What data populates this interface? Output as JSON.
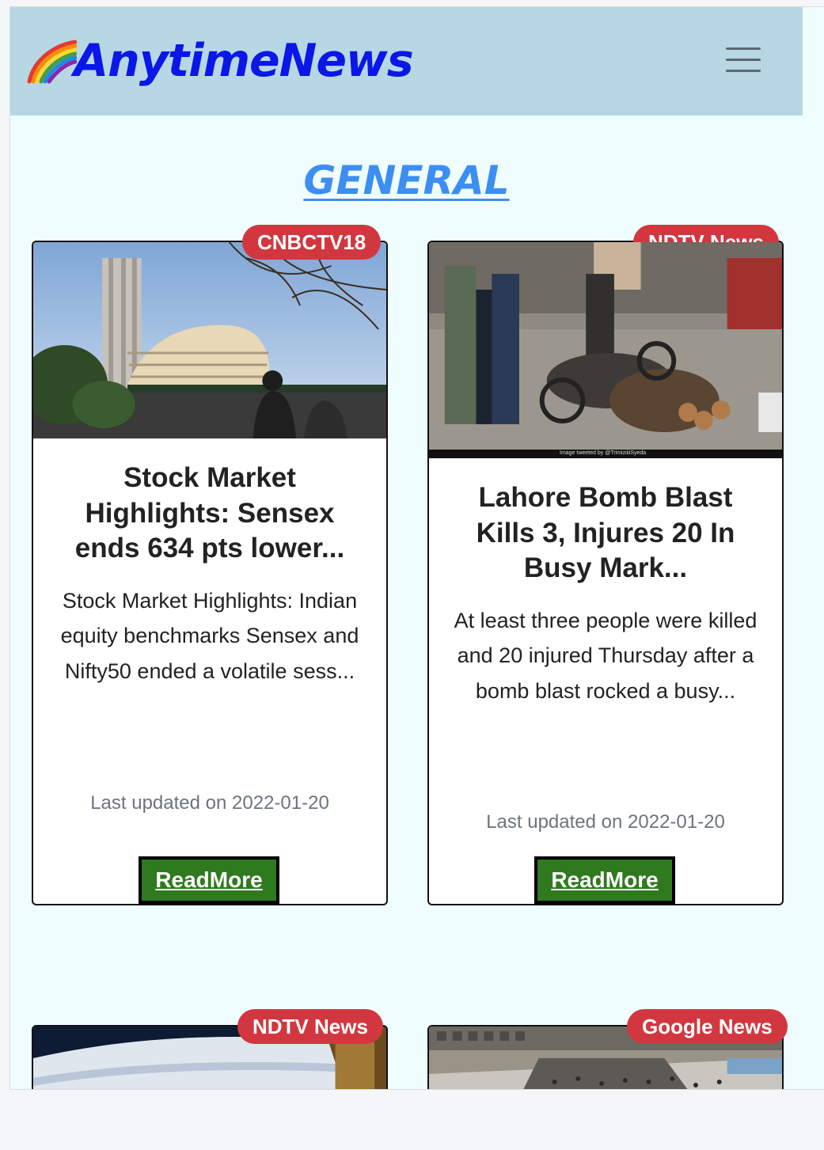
{
  "app": {
    "brand": "AnytimeNews",
    "brand_icon": "rainbow-icon",
    "menu_icon": "hamburger-menu-icon",
    "colors": {
      "navbar": "#b6d7e3",
      "brand": "#0a17e8",
      "title": "#3d8ef2",
      "badge": "#d2373f",
      "readmore": "#2f7a1f",
      "page_bg": "#f0fdff"
    }
  },
  "category_title": "GENERAL",
  "cards": [
    {
      "source": "CNBCTV18",
      "title": "Stock Market Highlights: Sensex ends 634 pts lower...",
      "description": "Stock Market Highlights: Indian equity benchmarks Sensex and Nifty50 ended a volatile sess...",
      "updated": "Last updated on 2022-01-20",
      "button": "ReadMore"
    },
    {
      "source": "NDTV News",
      "title": "Lahore Bomb Blast Kills 3, Injures 20 In Busy Mark...",
      "description": "At least three people were killed and 20 injured Thursday after a bomb blast rocked a busy...",
      "updated": "Last updated on 2022-01-20",
      "button": "ReadMore",
      "image_caption": "Image tweeted by @TrimiziiiiSyeda"
    },
    {
      "source": "NDTV News"
    },
    {
      "source": "Google News"
    }
  ]
}
